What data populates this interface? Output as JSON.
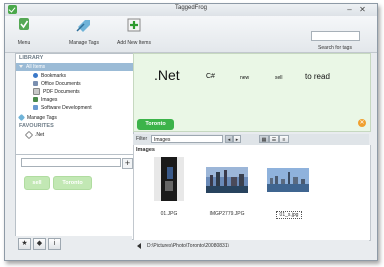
{
  "window": {
    "title": "TaggedFrog"
  },
  "toolbar": {
    "menu_label": "Menu",
    "manage_tags_label": "Manage Tags",
    "add_items_label": "Add New Items",
    "search_label": "Search for tags",
    "search_value": ""
  },
  "sidebar": {
    "library_header": "LIBRARY",
    "all_items": "All Items",
    "items": [
      {
        "label": "Bookmarks",
        "icon": "globe-icon",
        "color": "#3a78c8"
      },
      {
        "label": "Office Documents",
        "icon": "document-icon",
        "color": "#7a8fb0"
      },
      {
        "label": "PDF Documents",
        "icon": "pdf-icon",
        "color": "#c8c8c8"
      },
      {
        "label": "Images",
        "icon": "image-icon",
        "color": "#4a8a4a"
      },
      {
        "label": "Software Development",
        "icon": "code-icon",
        "color": "#6a9ad0"
      }
    ],
    "manage_tags": "Manage Tags",
    "favourites_header": "FAVOURITES",
    "favourites": [
      {
        "label": ".Net"
      }
    ]
  },
  "tag_panel": {
    "input_value": "",
    "add_symbol": "+",
    "tags": [
      "sell",
      "Toronto"
    ]
  },
  "bottom_buttons": [
    {
      "symbol": "★",
      "icon": "star-icon"
    },
    {
      "symbol": "◆",
      "icon": "tag-icon"
    },
    {
      "symbol": "i",
      "icon": "info-icon"
    }
  ],
  "tag_cloud": [
    {
      "label": ".Net",
      "size": 14
    },
    {
      "label": "C#",
      "size": 7
    },
    {
      "label": "new",
      "size": 5
    },
    {
      "label": "sell",
      "size": 5
    },
    {
      "label": "to read",
      "size": 8
    }
  ],
  "selected_tags": [
    "Toronto"
  ],
  "filter": {
    "label": "Filter",
    "value": "Images"
  },
  "content": {
    "section_label": "Images",
    "thumbnails": [
      {
        "filename": "01.JPG"
      },
      {
        "filename": "IMGP2779.JPG"
      },
      {
        "filename": "01_s.jpg"
      }
    ]
  },
  "path": "D:\\Pictures\\Photo\\Toronto\\20080831\\"
}
